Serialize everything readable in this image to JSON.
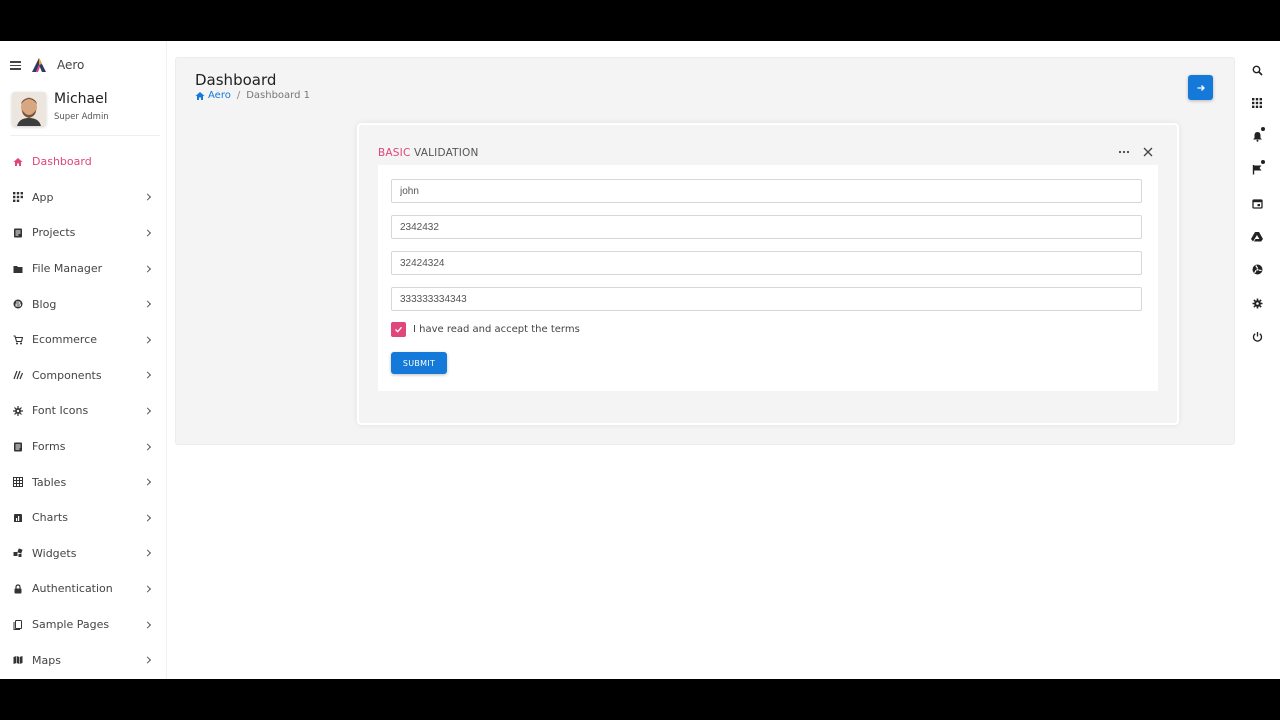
{
  "brand": {
    "name": "Aero",
    "logo_icon": "aero-logo-icon"
  },
  "profile": {
    "name": "Michael",
    "role": "Super Admin"
  },
  "sidebar": {
    "accent_color": "#e0457b",
    "items": [
      {
        "label": "Dashboard",
        "icon": "home-icon",
        "active": true
      },
      {
        "label": "App",
        "icon": "apps-grid-icon"
      },
      {
        "label": "Projects",
        "icon": "projects-icon"
      },
      {
        "label": "File Manager",
        "icon": "folder-icon"
      },
      {
        "label": "Blog",
        "icon": "blog-icon"
      },
      {
        "label": "Ecommerce",
        "icon": "cart-icon"
      },
      {
        "label": "Components",
        "icon": "components-icon"
      },
      {
        "label": "Font Icons",
        "icon": "font-icons-icon"
      },
      {
        "label": "Forms",
        "icon": "forms-icon"
      },
      {
        "label": "Tables",
        "icon": "tables-icon"
      },
      {
        "label": "Charts",
        "icon": "charts-icon"
      },
      {
        "label": "Widgets",
        "icon": "widgets-icon"
      },
      {
        "label": "Authentication",
        "icon": "lock-icon"
      },
      {
        "label": "Sample Pages",
        "icon": "pages-icon"
      },
      {
        "label": "Maps",
        "icon": "map-icon"
      }
    ]
  },
  "header": {
    "title": "Dashboard",
    "breadcrumb": {
      "home": "Aero",
      "separator": "/",
      "current": "Dashboard 1"
    }
  },
  "card": {
    "title_accent": "BASIC",
    "title_rest": " VALIDATION",
    "fields": [
      {
        "value": "john"
      },
      {
        "value": "2342432"
      },
      {
        "value": "32424324"
      },
      {
        "value": "333333334343"
      }
    ],
    "terms_label": "I have read and accept the terms",
    "terms_checked": true,
    "submit_label": "SUBMIT"
  },
  "colors": {
    "primary": "#1479d8",
    "accent": "#e0457b"
  },
  "right_rail": [
    {
      "icon": "search-icon"
    },
    {
      "icon": "apps-grid-icon"
    },
    {
      "icon": "bell-icon",
      "badge": true
    },
    {
      "icon": "flag-icon",
      "badge": true
    },
    {
      "icon": "calendar-icon"
    },
    {
      "icon": "drive-icon"
    },
    {
      "icon": "radiation-icon"
    },
    {
      "icon": "gear-icon"
    },
    {
      "icon": "power-icon"
    }
  ]
}
